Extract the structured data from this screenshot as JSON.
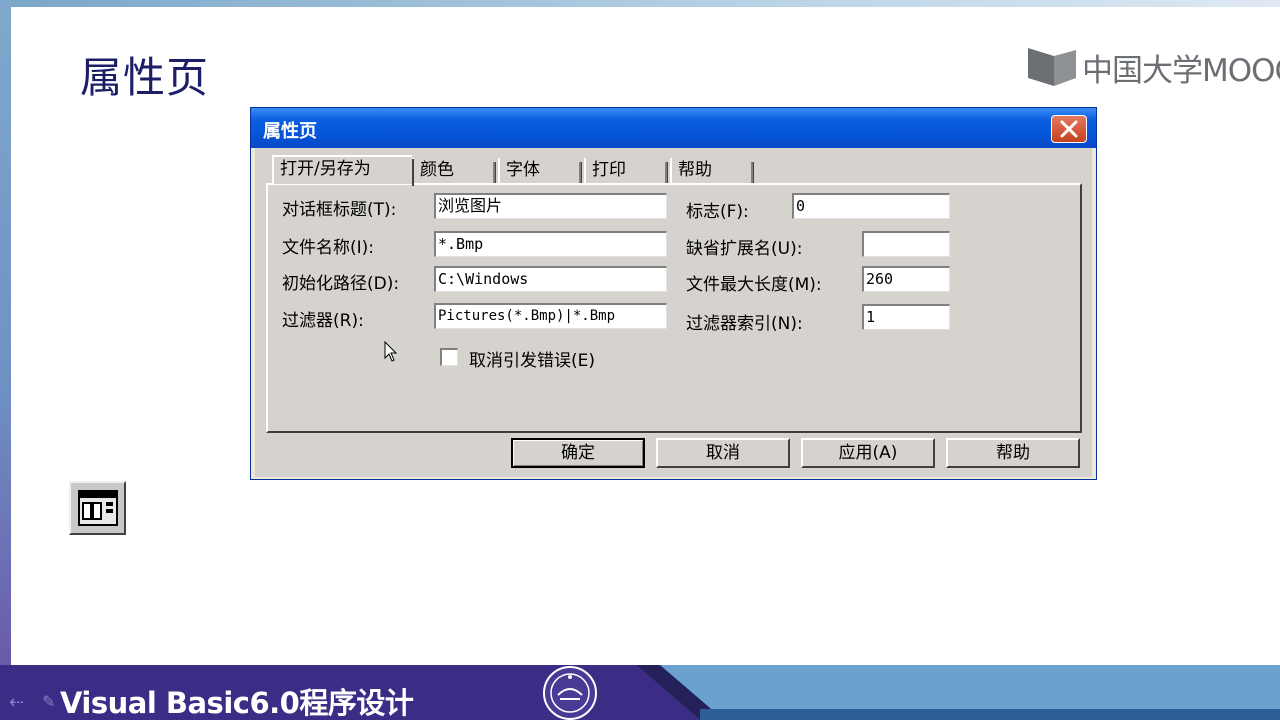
{
  "slide": {
    "title": "属性页",
    "logo_text": "中国大学MOOC",
    "footer_title": "Visual Basic6.0程序设计",
    "footer_nav_icon": "left-arrow-icon",
    "footer_pencil_icon": "pencil-icon"
  },
  "dialog": {
    "title": "属性页",
    "close_icon": "close-icon",
    "tabs": [
      {
        "label": "打开/另存为",
        "active": true
      },
      {
        "label": "颜色"
      },
      {
        "label": "字体"
      },
      {
        "label": "打印"
      },
      {
        "label": "帮助"
      }
    ],
    "fields": {
      "dialog_title": {
        "label": "对话框标题(T):",
        "value": "浏览图片"
      },
      "file_name": {
        "label": "文件名称(I):",
        "value": "*.Bmp"
      },
      "init_dir": {
        "label": "初始化路径(D):",
        "value": "C:\\Windows"
      },
      "filter": {
        "label": "过滤器(R):",
        "value": "Pictures(*.Bmp)|*.Bmp"
      },
      "flags": {
        "label": "标志(F):",
        "value": "0"
      },
      "default_ext": {
        "label": "缺省扩展名(U):",
        "value": ""
      },
      "max_file_size": {
        "label": "文件最大长度(M):",
        "value": "260"
      },
      "filter_index": {
        "label": "过滤器索引(N):",
        "value": "1"
      }
    },
    "cancel_error": {
      "label": "取消引发错误(E)",
      "checked": false
    },
    "buttons": {
      "ok": "确定",
      "cancel": "取消",
      "apply": "应用(A)",
      "help": "帮助"
    }
  },
  "toolbox_icon": "common-dialog-control-icon",
  "colors": {
    "titlebar": "#0654d8",
    "slide_title": "#1c1f66",
    "footer_dark": "#3d2c86",
    "footer_light": "#6aa1cf",
    "dialog_face": "#d6d3ce"
  }
}
